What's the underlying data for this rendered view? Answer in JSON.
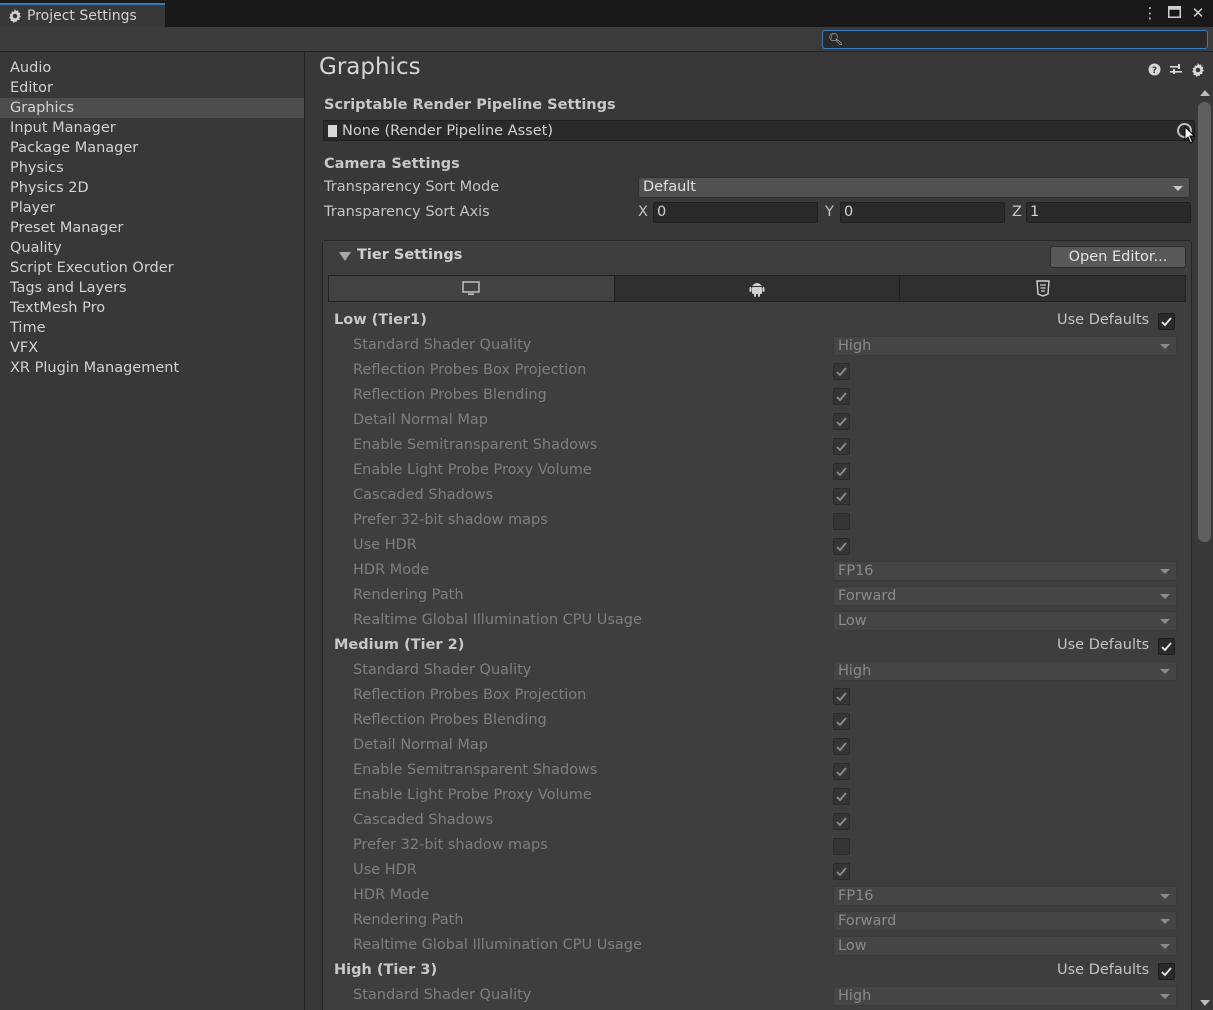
{
  "window": {
    "tab_title": "Project Settings",
    "icons": [
      "kebab-menu-icon",
      "maximize-icon",
      "close-icon"
    ]
  },
  "search": {
    "placeholder": "",
    "value": ""
  },
  "sidebar": {
    "items": [
      {
        "label": "Audio",
        "active": false
      },
      {
        "label": "Editor",
        "active": false
      },
      {
        "label": "Graphics",
        "active": true
      },
      {
        "label": "Input Manager",
        "active": false
      },
      {
        "label": "Package Manager",
        "active": false
      },
      {
        "label": "Physics",
        "active": false
      },
      {
        "label": "Physics 2D",
        "active": false
      },
      {
        "label": "Player",
        "active": false
      },
      {
        "label": "Preset Manager",
        "active": false
      },
      {
        "label": "Quality",
        "active": false
      },
      {
        "label": "Script Execution Order",
        "active": false
      },
      {
        "label": "Tags and Layers",
        "active": false
      },
      {
        "label": "TextMesh Pro",
        "active": false
      },
      {
        "label": "Time",
        "active": false
      },
      {
        "label": "VFX",
        "active": false
      },
      {
        "label": "XR Plugin Management",
        "active": false
      }
    ]
  },
  "main": {
    "title": "Graphics",
    "srp": {
      "section_label": "Scriptable Render Pipeline Settings",
      "field_value": "None (Render Pipeline Asset)"
    },
    "camera": {
      "section_label": "Camera Settings",
      "sort_mode_label": "Transparency Sort Mode",
      "sort_mode_value": "Default",
      "sort_axis_label": "Transparency Sort Axis",
      "axis_x_label": "X",
      "axis_x_value": "0",
      "axis_y_label": "Y",
      "axis_y_value": "0",
      "axis_z_label": "Z",
      "axis_z_value": "1"
    },
    "tier_settings": {
      "title": "Tier Settings",
      "open_editor_label": "Open Editor...",
      "platform_tabs": [
        "desktop-icon",
        "android-icon",
        "html5-icon"
      ],
      "use_defaults_label": "Use Defaults",
      "tiers": [
        {
          "title": "Low (Tier1)",
          "use_defaults": true,
          "rows": [
            {
              "label": "Standard Shader Quality",
              "type": "dropdown",
              "value": "High"
            },
            {
              "label": "Reflection Probes Box Projection",
              "type": "checkbox",
              "checked": true
            },
            {
              "label": "Reflection Probes Blending",
              "type": "checkbox",
              "checked": true
            },
            {
              "label": "Detail Normal Map",
              "type": "checkbox",
              "checked": true
            },
            {
              "label": "Enable Semitransparent Shadows",
              "type": "checkbox",
              "checked": true
            },
            {
              "label": "Enable Light Probe Proxy Volume",
              "type": "checkbox",
              "checked": true
            },
            {
              "label": "Cascaded Shadows",
              "type": "checkbox",
              "checked": true
            },
            {
              "label": "Prefer 32-bit shadow maps",
              "type": "checkbox",
              "checked": false
            },
            {
              "label": "Use HDR",
              "type": "checkbox",
              "checked": true
            },
            {
              "label": "HDR Mode",
              "type": "dropdown",
              "value": "FP16"
            },
            {
              "label": "Rendering Path",
              "type": "dropdown",
              "value": "Forward"
            },
            {
              "label": "Realtime Global Illumination CPU Usage",
              "type": "dropdown",
              "value": "Low"
            }
          ]
        },
        {
          "title": "Medium (Tier 2)",
          "use_defaults": true,
          "rows": [
            {
              "label": "Standard Shader Quality",
              "type": "dropdown",
              "value": "High"
            },
            {
              "label": "Reflection Probes Box Projection",
              "type": "checkbox",
              "checked": true
            },
            {
              "label": "Reflection Probes Blending",
              "type": "checkbox",
              "checked": true
            },
            {
              "label": "Detail Normal Map",
              "type": "checkbox",
              "checked": true
            },
            {
              "label": "Enable Semitransparent Shadows",
              "type": "checkbox",
              "checked": true
            },
            {
              "label": "Enable Light Probe Proxy Volume",
              "type": "checkbox",
              "checked": true
            },
            {
              "label": "Cascaded Shadows",
              "type": "checkbox",
              "checked": true
            },
            {
              "label": "Prefer 32-bit shadow maps",
              "type": "checkbox",
              "checked": false
            },
            {
              "label": "Use HDR",
              "type": "checkbox",
              "checked": true
            },
            {
              "label": "HDR Mode",
              "type": "dropdown",
              "value": "FP16"
            },
            {
              "label": "Rendering Path",
              "type": "dropdown",
              "value": "Forward"
            },
            {
              "label": "Realtime Global Illumination CPU Usage",
              "type": "dropdown",
              "value": "Low"
            }
          ]
        },
        {
          "title": "High (Tier 3)",
          "use_defaults": true,
          "rows": [
            {
              "label": "Standard Shader Quality",
              "type": "dropdown",
              "value": "High"
            }
          ]
        }
      ]
    }
  }
}
